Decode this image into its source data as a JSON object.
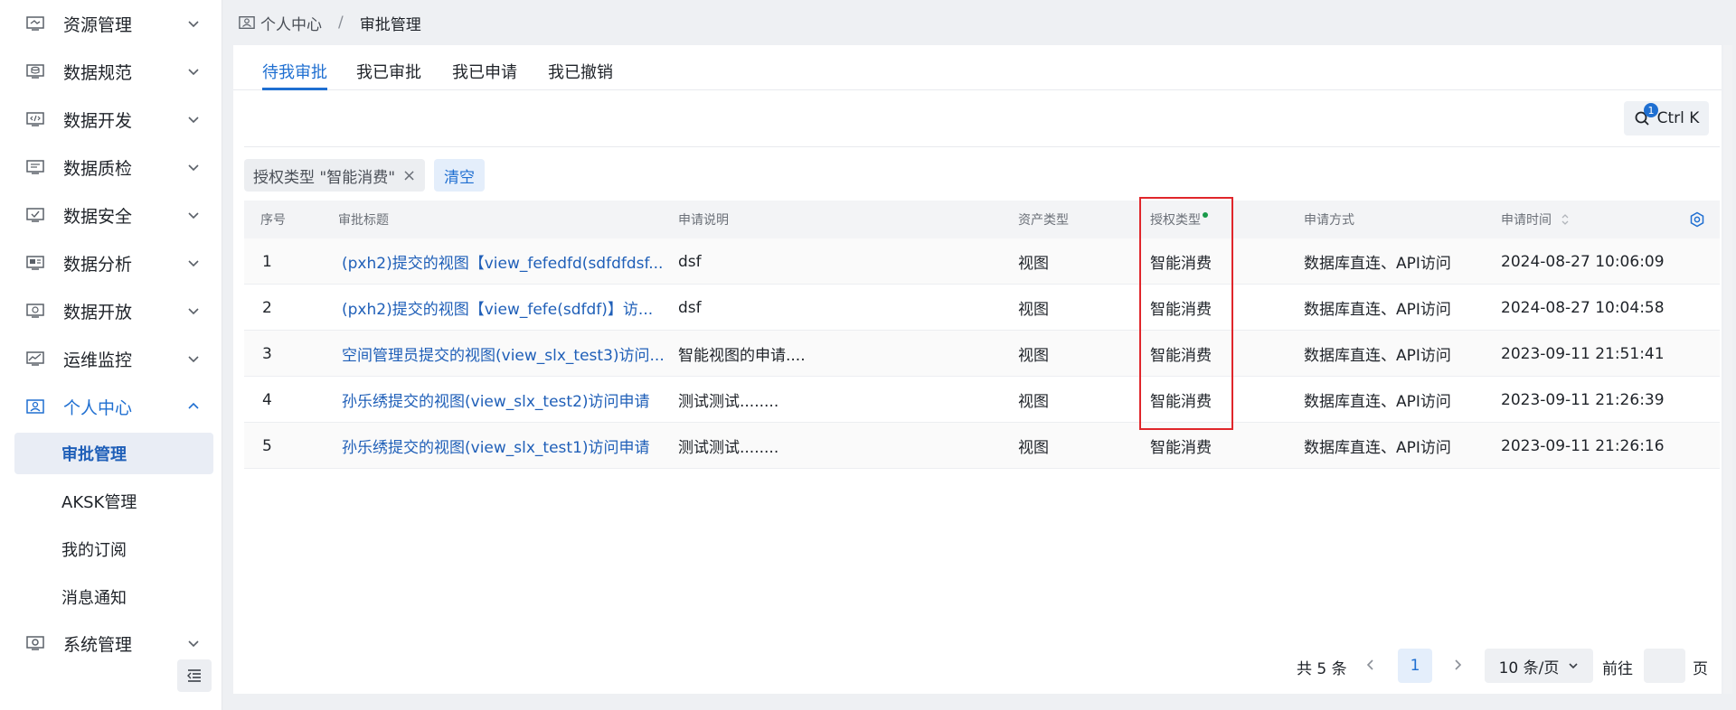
{
  "sidebar": {
    "menu": [
      {
        "label": "资源管理",
        "icon": "resource-icon"
      },
      {
        "label": "数据规范",
        "icon": "database-icon"
      },
      {
        "label": "数据开发",
        "icon": "code-icon"
      },
      {
        "label": "数据质检",
        "icon": "quality-icon"
      },
      {
        "label": "数据安全",
        "icon": "security-icon"
      },
      {
        "label": "数据分析",
        "icon": "analysis-icon"
      },
      {
        "label": "数据开放",
        "icon": "open-data-icon"
      },
      {
        "label": "运维监控",
        "icon": "monitor-icon"
      },
      {
        "label": "个人中心",
        "icon": "personal-icon"
      }
    ],
    "personal_sub": [
      "审批管理",
      "AKSK管理",
      "我的订阅",
      "消息通知"
    ],
    "system": {
      "label": "系统管理",
      "icon": "system-icon"
    }
  },
  "breadcrumb": {
    "parent": "个人中心",
    "separator": "/",
    "current": "审批管理"
  },
  "tabs": [
    "待我审批",
    "我已审批",
    "我已申请",
    "我已撤销"
  ],
  "search": {
    "shortcut": "Ctrl K",
    "badge": "1"
  },
  "filter": {
    "tag": "授权类型 \"智能消费\"",
    "clear_label": "清空"
  },
  "table": {
    "headers": [
      "序号",
      "审批标题",
      "申请说明",
      "资产类型",
      "授权类型",
      "申请方式",
      "申请时间"
    ],
    "rows": [
      [
        "1",
        "(pxh2)提交的视图【view_fefedfd(sdfdfdsf...",
        "dsf",
        "视图",
        "智能消费",
        "数据库直连、API访问",
        "2024-08-27 10:06:09"
      ],
      [
        "2",
        "(pxh2)提交的视图【view_fefe(sdfdf)】访...",
        "dsf",
        "视图",
        "智能消费",
        "数据库直连、API访问",
        "2024-08-27 10:04:58"
      ],
      [
        "3",
        "空间管理员提交的视图(view_slx_test3)访问...",
        "智能视图的申请....",
        "视图",
        "智能消费",
        "数据库直连、API访问",
        "2023-09-11 21:51:41"
      ],
      [
        "4",
        "孙乐绣提交的视图(view_slx_test2)访问申请",
        "测试测试........",
        "视图",
        "智能消费",
        "数据库直连、API访问",
        "2023-09-11 21:26:39"
      ],
      [
        "5",
        "孙乐绣提交的视图(view_slx_test1)访问申请",
        "测试测试........",
        "视图",
        "智能消费",
        "数据库直连、API访问",
        "2023-09-11 21:26:16"
      ]
    ]
  },
  "pagination": {
    "total": "共 5 条",
    "current_page": "1",
    "page_size": "10 条/页",
    "goto": "前往",
    "page_unit": "页"
  },
  "colors": {
    "accent": "#1f6fd1",
    "highlight": "#e0262b"
  }
}
